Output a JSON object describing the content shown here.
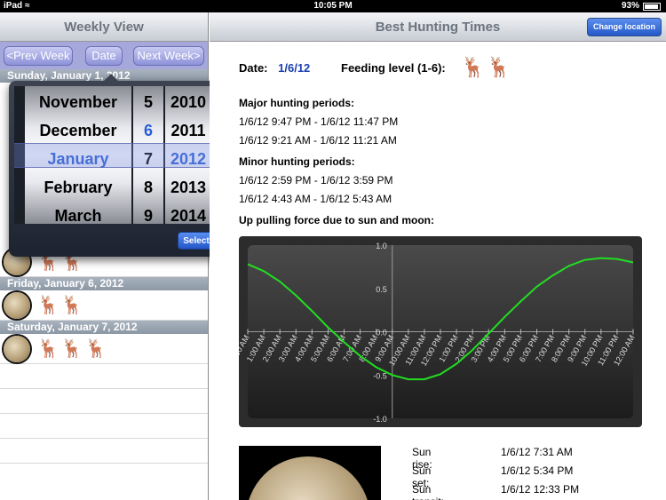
{
  "status": {
    "carrier": "iPad",
    "time": "10:05 PM",
    "battery": "93%"
  },
  "left": {
    "title": "Weekly View",
    "prev_week": "<Prev Week",
    "date": "Date",
    "next_week": "Next Week>",
    "partial_header": "Sunday, January 1, 2012",
    "day_headers": [
      "Friday, January 6, 2012",
      "Saturday, January 7, 2012"
    ]
  },
  "picker": {
    "months": [
      "November",
      "December",
      "January",
      "February",
      "March"
    ],
    "days": [
      "5",
      "6",
      "7",
      "8",
      "9"
    ],
    "years": [
      "2010",
      "2011",
      "2012",
      "2013",
      "2014"
    ],
    "select_label": "Select"
  },
  "right": {
    "title": "Best Hunting Times",
    "change_location": "Change location",
    "date_label": "Date:",
    "date_value": "1/6/12",
    "feeding_label": "Feeding level (1-6):",
    "major_title": "Major hunting periods:",
    "major": [
      "1/6/12 9:47 PM - 1/6/12 11:47 PM",
      "1/6/12 9:21 AM - 1/6/12 11:21 AM"
    ],
    "minor_title": "Minor hunting periods:",
    "minor": [
      "1/6/12 2:59 PM - 1/6/12 3:59 PM",
      "1/6/12 4:43 AM - 1/6/12 5:43 AM"
    ],
    "force_title": "Up pulling force due to sun and moon:",
    "sun_rise_label": "Sun rise:",
    "sun_rise": "1/6/12 7:31 AM",
    "sun_set_label": "Sun set:",
    "sun_set": "1/6/12 5:34 PM",
    "sun_transit_label": "Sun transit:",
    "sun_transit": "1/6/12 12:33 PM"
  },
  "chart_data": {
    "type": "line",
    "x": [
      "12:00 AM",
      "1:00 AM",
      "2:00 AM",
      "3:00 AM",
      "4:00 AM",
      "5:00 AM",
      "6:00 AM",
      "7:00 AM",
      "8:00 AM",
      "9:00 AM",
      "10:00 AM",
      "11:00 AM",
      "12:00 PM",
      "1:00 PM",
      "2:00 PM",
      "3:00 PM",
      "4:00 PM",
      "5:00 PM",
      "6:00 PM",
      "7:00 PM",
      "8:00 PM",
      "9:00 PM",
      "10:00 PM",
      "11:00 PM",
      "12:00 AM"
    ],
    "y": [
      0.78,
      0.7,
      0.58,
      0.42,
      0.24,
      0.05,
      -0.12,
      -0.28,
      -0.41,
      -0.5,
      -0.55,
      -0.55,
      -0.49,
      -0.37,
      -0.21,
      -0.02,
      0.17,
      0.35,
      0.52,
      0.65,
      0.76,
      0.83,
      0.85,
      0.84,
      0.8
    ],
    "yticks": [
      "1.0",
      "0.5",
      "0.0",
      "-0.5",
      "-1.0"
    ],
    "ylim": [
      -1,
      1
    ],
    "color": "#22dd22",
    "grid": true
  }
}
